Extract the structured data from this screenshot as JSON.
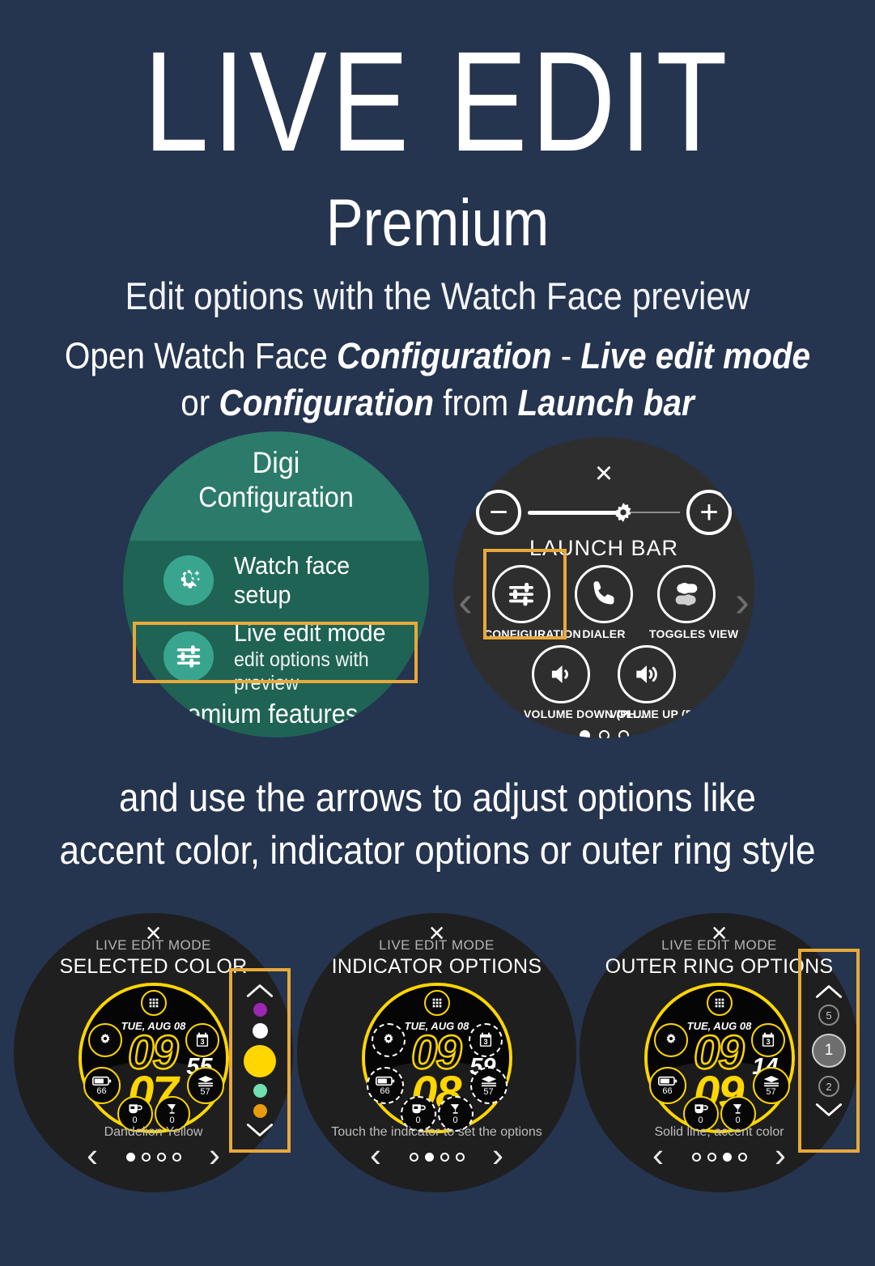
{
  "header": {
    "title": "LIVE EDIT",
    "subtitle": "Premium",
    "tagline": "Edit options with the Watch Face preview",
    "instruction_line1_pre": "Open Watch Face ",
    "instruction_line1_b1": "Configuration",
    "instruction_line1_mid": " - ",
    "instruction_line1_b2": "Live edit mode",
    "instruction_line2_pre": "or ",
    "instruction_line2_b1": "Configuration",
    "instruction_line2_mid": " from ",
    "instruction_line2_b2": "Launch bar"
  },
  "middle": {
    "line1": "and use the arrows to adjust options like",
    "line2": "accent color, indicator options or outer ring style"
  },
  "config_watch": {
    "title": "Digi",
    "subtitle": "Configuration",
    "rows": [
      {
        "label": "Watch face setup",
        "sub": "",
        "icon": "gear-sparkle-icon"
      },
      {
        "label": "Live edit mode",
        "sub": "edit options with preview",
        "icon": "sliders-icon"
      }
    ],
    "footer": "Premium features",
    "highlight_color": "#e8a93a",
    "bg_top": "#2b7a6a",
    "bg_bottom": "#1f6355",
    "icon_bg": "#3aa58f"
  },
  "launch_bar": {
    "close": "×",
    "label": "LAUNCH BAR",
    "minus": "−",
    "plus": "+",
    "tiles_row1": [
      {
        "caption": "CONFIGURATION",
        "icon": "sliders-icon",
        "highlighted": true
      },
      {
        "caption": "DIALER",
        "icon": "phone-icon",
        "highlighted": false
      },
      {
        "caption": "TOGGLES VIEW",
        "icon": "toggles-icon",
        "highlighted": false
      }
    ],
    "tiles_row2": [
      {
        "caption": "VOLUME DOWN (PH…",
        "icon": "volume-down-icon"
      },
      {
        "caption": "VOLUME UP (PHONE)",
        "icon": "volume-up-icon"
      }
    ],
    "arrow_left": "‹",
    "arrow_right": "›",
    "page_dots": 3,
    "page_active": 0
  },
  "previews": [
    {
      "close": "×",
      "mode": "LIVE EDIT MODE",
      "heading": "SELECTED COLOR",
      "footer": "Dandelion Yellow",
      "dots": 4,
      "active": 0,
      "nav_left": "‹",
      "nav_right": "›",
      "watch": {
        "date": "TUE, AUG 08",
        "hour": "09",
        "minute": "07",
        "seconds": "55",
        "battery": "66",
        "steps": "57",
        "cup1": "0",
        "cup2": "0",
        "accent": "#FFD600",
        "indicator_style": "solid"
      },
      "stepper": {
        "type": "color-swatches",
        "up": "⌃",
        "down": "⌄",
        "swatches": [
          {
            "color": "#9c27b0",
            "size": 17
          },
          {
            "color": "#ffffff",
            "size": 19
          },
          {
            "color": "#FFD600",
            "size": 40
          },
          {
            "color": "#6fe0b0",
            "size": 17
          },
          {
            "color": "#e89b0c",
            "size": 17
          }
        ]
      }
    },
    {
      "close": "×",
      "mode": "LIVE EDIT MODE",
      "heading": "INDICATOR OPTIONS",
      "footer": "Touch the indicator to set the options",
      "dots": 4,
      "active": 1,
      "nav_left": "‹",
      "nav_right": "›",
      "watch": {
        "date": "TUE, AUG 08",
        "hour": "09",
        "minute": "08",
        "seconds": "59",
        "battery": "66",
        "steps": "57",
        "cup1": "0",
        "cup2": "0",
        "accent": "#FFD600",
        "indicator_style": "dashed"
      },
      "stepper": null
    },
    {
      "close": "×",
      "mode": "LIVE EDIT MODE",
      "heading": "OUTER RING OPTIONS",
      "footer": "Solid line, accent color",
      "dots": 4,
      "active": 2,
      "nav_left": "‹",
      "nav_right": "›",
      "watch": {
        "date": "TUE, AUG 08",
        "hour": "09",
        "minute": "09",
        "seconds": "14",
        "battery": "66",
        "steps": "57",
        "cup1": "0",
        "cup2": "0",
        "accent": "#FFD600",
        "indicator_style": "solid"
      },
      "stepper": {
        "type": "numbered-options",
        "up": "⌃",
        "down": "⌄",
        "options": [
          {
            "label": "5",
            "selected": false
          },
          {
            "label": "1",
            "selected": true
          },
          {
            "label": "2",
            "selected": false
          }
        ]
      }
    }
  ],
  "colors": {
    "background": "#25344f",
    "accent_yellow": "#FFD600",
    "highlight_orange": "#e8a93a",
    "dark_watch": "#1f1f1f"
  }
}
